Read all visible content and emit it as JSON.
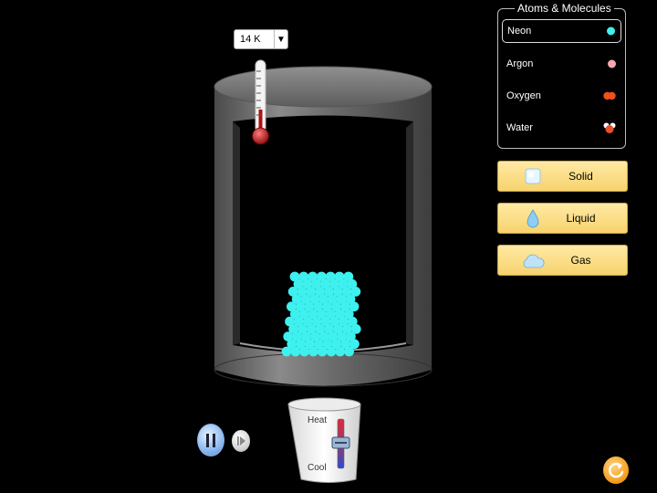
{
  "temperature": {
    "value": "14 K",
    "dropdown_arrow": "▼"
  },
  "atoms_panel": {
    "title": "Atoms & Molecules",
    "items": [
      {
        "label": "Neon",
        "icon": "neon-atom-icon",
        "color": "#3ef0ee",
        "selected": true
      },
      {
        "label": "Argon",
        "icon": "argon-atom-icon",
        "color": "#f5a8b0",
        "selected": false
      },
      {
        "label": "Oxygen",
        "icon": "oxygen-molecule-icon",
        "color": "#f0501a",
        "selected": false
      },
      {
        "label": "Water",
        "icon": "water-molecule-icon",
        "color": "#e8502a",
        "selected": false
      }
    ]
  },
  "phase_buttons": [
    {
      "label": "Solid",
      "icon": "ice-cube-icon"
    },
    {
      "label": "Liquid",
      "icon": "water-drop-icon"
    },
    {
      "label": "Gas",
      "icon": "cloud-icon"
    }
  ],
  "heat_cool": {
    "heat_label": "Heat",
    "cool_label": "Cool"
  },
  "playback": {
    "pause_icon": "pause-icon",
    "step_icon": "step-icon"
  },
  "reset": {
    "icon": "reset-icon"
  },
  "colors": {
    "particle": "#3ef0ee",
    "button_fill": "#f9dc80",
    "container": "#666666"
  }
}
